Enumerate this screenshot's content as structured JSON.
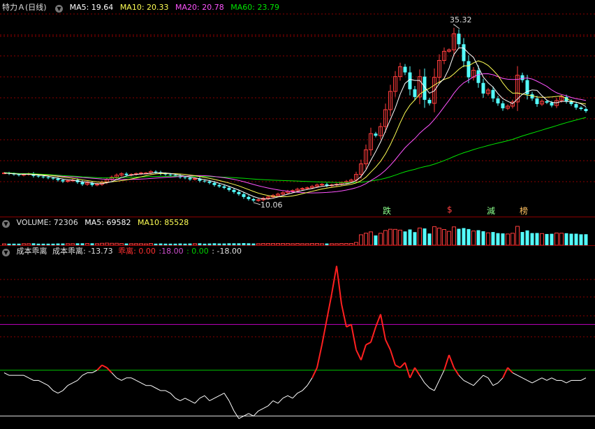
{
  "main": {
    "title": "特力Ａ(日线)",
    "ma5": "MA5: 19.64",
    "ma10": "MA10: 20.33",
    "ma20": "MA20: 20.78",
    "ma60": "MA60: 23.79",
    "high_label": "35.32",
    "low_label": "10.06",
    "signals": [
      "跌",
      "$",
      "減",
      "榜"
    ]
  },
  "volume": {
    "label": "VOLUME: 72306",
    "ma5": "MA5: 69582",
    "ma10": "MA10: 85528"
  },
  "indicator": {
    "name": "成本乖离",
    "label": "成本乖离: -13.73",
    "red_label": "乖离: 0.00",
    "purple_label": ":18.00",
    "green_label": ": 0.00",
    "white_label": ": -18.00"
  },
  "colors": {
    "up": "#ff3c3c",
    "down": "#54ffff",
    "ma5": "#ffffff",
    "ma10": "#ffff54",
    "ma20": "#ff54ff",
    "ma60": "#00e600",
    "purple_line": "#c000c0",
    "green_line": "#00c800",
    "grid": "#8b0000"
  },
  "chart_data": [
    {
      "type": "candlestick",
      "title": "特力Ａ(日线)",
      "ylim": [
        9,
        37
      ],
      "x": [
        1,
        2,
        3,
        4,
        5,
        6,
        7,
        8,
        9,
        10,
        11,
        12,
        13,
        14,
        15,
        16,
        17,
        18,
        19,
        20,
        21,
        22,
        23,
        24,
        25,
        26,
        27,
        28,
        29,
        30,
        31,
        32,
        33,
        34,
        35,
        36,
        37,
        38,
        39,
        40,
        41,
        42,
        43,
        44,
        45,
        46,
        47,
        48,
        49,
        50,
        51,
        52,
        53,
        54,
        55,
        56,
        57,
        58,
        59,
        60,
        61,
        62,
        63,
        64,
        65,
        66,
        67,
        68,
        69,
        70,
        71,
        72,
        73,
        74,
        75,
        76,
        77,
        78,
        79,
        80,
        81,
        82,
        83,
        84,
        85,
        86,
        87,
        88,
        89,
        90,
        91,
        92,
        93,
        94,
        95,
        96,
        97,
        98,
        99,
        100,
        101,
        102,
        103,
        104,
        105,
        106,
        107,
        108,
        109,
        110,
        111,
        112,
        113,
        114,
        115,
        116,
        117,
        118,
        119,
        120
      ],
      "close": [
        14.2,
        14.1,
        14.0,
        13.9,
        14.0,
        14.1,
        13.8,
        13.7,
        13.6,
        13.5,
        13.4,
        13.2,
        13.0,
        13.1,
        13.2,
        12.9,
        12.6,
        12.8,
        12.5,
        12.6,
        12.9,
        13.3,
        13.6,
        13.9,
        14.1,
        13.9,
        14.0,
        14.1,
        14.2,
        14.2,
        14.4,
        14.3,
        14.1,
        14.0,
        13.9,
        13.8,
        13.6,
        13.5,
        13.3,
        13.4,
        13.1,
        13.0,
        12.8,
        12.5,
        12.3,
        12.1,
        11.8,
        11.5,
        11.2,
        10.8,
        10.5,
        10.3,
        10.4,
        10.6,
        10.8,
        11.0,
        11.2,
        11.4,
        11.6,
        11.7,
        11.9,
        12.0,
        12.1,
        12.3,
        12.5,
        12.6,
        12.4,
        12.5,
        12.6,
        12.8,
        13.0,
        13.2,
        14.0,
        15.5,
        17.5,
        19.8,
        19.5,
        20.8,
        23.2,
        25.8,
        27.9,
        29.3,
        28.5,
        26.1,
        25.0,
        27.9,
        24.6,
        24.1,
        27.8,
        30.2,
        31.5,
        31.7,
        34.0,
        32.5,
        30.1,
        27.8,
        28.8,
        27.0,
        25.5,
        26.0,
        24.8,
        24.1,
        23.4,
        23.7,
        24.3,
        28.1,
        27.4,
        25.4,
        24.8,
        24.0,
        24.4,
        24.2,
        23.8,
        24.5,
        25.0,
        24.4,
        24.0,
        23.5,
        23.3,
        23.0
      ],
      "volume_label": "VOLUME: 72306"
    },
    {
      "type": "line",
      "title": "成本乖离",
      "ylim": [
        -22,
        45
      ],
      "series": [
        {
          "name": "成本乖离",
          "values": [
            -1,
            -2,
            -2,
            -2,
            -2,
            -3,
            -4,
            -4,
            -5,
            -6,
            -8,
            -9,
            -8,
            -6,
            -5,
            -4,
            -2,
            -1,
            -1,
            0,
            2,
            1,
            -1,
            -3,
            -4,
            -3,
            -3,
            -4,
            -5,
            -6,
            -6,
            -7,
            -8,
            -8,
            -9,
            -11,
            -12,
            -11,
            -12,
            -13,
            -11,
            -10,
            -12,
            -11,
            -10,
            -9,
            -12,
            -16,
            -19,
            -18,
            -17,
            -18,
            -16,
            -15,
            -14,
            -12,
            -13,
            -11,
            -10,
            -11,
            -9,
            -8,
            -6,
            -3,
            1,
            10,
            20,
            30,
            41,
            26,
            17,
            18,
            8,
            4,
            10,
            11,
            17,
            22,
            12,
            8,
            2,
            1,
            3,
            -3,
            1,
            -2,
            -5,
            -7,
            -8,
            -4,
            0,
            6,
            1,
            -2,
            -4,
            -5,
            -6,
            -4,
            -2,
            -3,
            -6,
            -5,
            -3,
            1,
            -1,
            -2,
            -3,
            -4,
            -5,
            -4,
            -3,
            -4,
            -3,
            -4,
            -4,
            -5,
            -4,
            -4,
            -4,
            -3
          ]
        }
      ]
    }
  ]
}
